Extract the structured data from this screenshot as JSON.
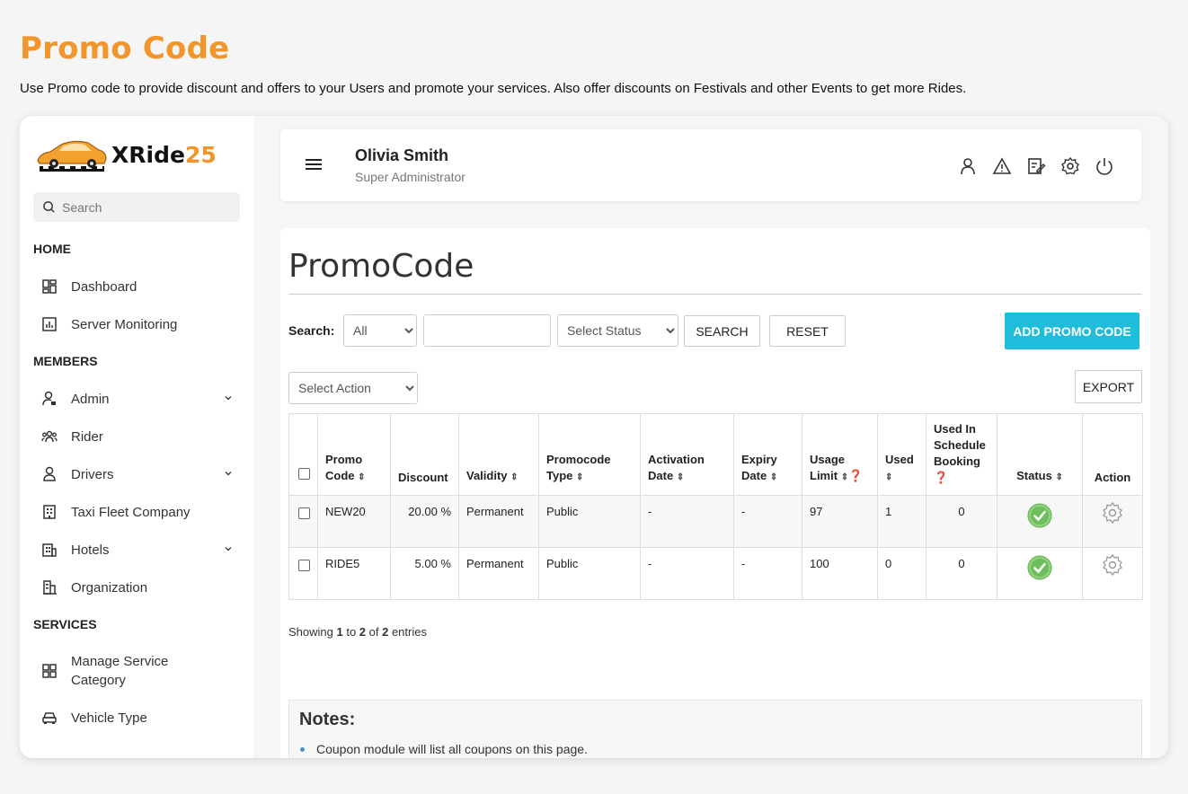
{
  "page": {
    "heading": "Promo Code",
    "description": "Use Promo code to provide discount and offers to your Users and promote your services. Also offer discounts on Festivals and other Events to get more Rides."
  },
  "brand": {
    "name_text": "XRide",
    "name_num": "25",
    "accent": "#f2962b"
  },
  "sidebar": {
    "search_placeholder": "Search",
    "sections": {
      "home": "HOME",
      "members": "MEMBERS",
      "services": "SERVICES"
    },
    "items": {
      "dashboard": {
        "label": "Dashboard",
        "icon": "dashboard-icon"
      },
      "server_monitoring": {
        "label": "Server Monitoring",
        "icon": "chart-icon"
      },
      "admin": {
        "label": "Admin",
        "icon": "user-lock-icon"
      },
      "rider": {
        "label": "Rider",
        "icon": "users-icon"
      },
      "drivers": {
        "label": "Drivers",
        "icon": "driver-icon"
      },
      "taxi_fleet": {
        "label": "Taxi Fleet Company",
        "icon": "building-icon"
      },
      "hotels": {
        "label": "Hotels",
        "icon": "hotel-icon"
      },
      "organization": {
        "label": "Organization",
        "icon": "organization-icon"
      },
      "manage_service_1": {
        "label": "Manage Service",
        "icon": "grid-icon"
      },
      "manage_service_2": {
        "label": "Category"
      },
      "vehicle_type": {
        "label": "Vehicle Type",
        "icon": "car-icon"
      }
    }
  },
  "header": {
    "user_name": "Olivia Smith",
    "user_role": "Super Administrator",
    "icons": [
      "user-icon",
      "alert-icon",
      "edit-icon",
      "settings-icon",
      "power-icon"
    ]
  },
  "main": {
    "title": "PromoCode",
    "search_label": "Search:",
    "search_field_select": "All",
    "search_input_value": "",
    "status_select": "Select Status",
    "search_button": "SEARCH",
    "reset_button": "RESET",
    "add_button": "ADD PROMO CODE",
    "action_select": "Select Action",
    "export_button": "EXPORT",
    "colors": {
      "add_button": "#20bcdc",
      "status_ok": "#8fd17f"
    }
  },
  "table": {
    "headers": {
      "promo_code_1": "Promo",
      "promo_code_2": "Code",
      "discount": "Discount",
      "validity": "Validity",
      "promocode_type_1": "Promocode",
      "promocode_type_2": "Type",
      "activation_1": "Activation",
      "activation_2": "Date",
      "expiry_1": "Expiry",
      "expiry_2": "Date",
      "usage_1": "Usage",
      "usage_2": "Limit",
      "used": "Used",
      "schedule_1": "Used In",
      "schedule_2": "Schedule",
      "schedule_3": "Booking",
      "status": "Status",
      "action": "Action"
    },
    "rows": [
      {
        "code": "NEW20",
        "discount": "20.00 %",
        "validity": "Permanent",
        "type": "Public",
        "activation": "-",
        "expiry": "-",
        "usage_limit": "97",
        "used": "1",
        "schedule_used": "0"
      },
      {
        "code": "RIDE5",
        "discount": "5.00 %",
        "validity": "Permanent",
        "type": "Public",
        "activation": "-",
        "expiry": "-",
        "usage_limit": "100",
        "used": "0",
        "schedule_used": "0"
      }
    ]
  },
  "entries": {
    "prefix": "Showing ",
    "from": "1",
    "to_text": " to ",
    "to": "2",
    "of_text": " of ",
    "total": "2",
    "suffix": " entries"
  },
  "notes": {
    "title": "Notes:",
    "items": [
      "Coupon module will list all coupons on this page."
    ]
  }
}
